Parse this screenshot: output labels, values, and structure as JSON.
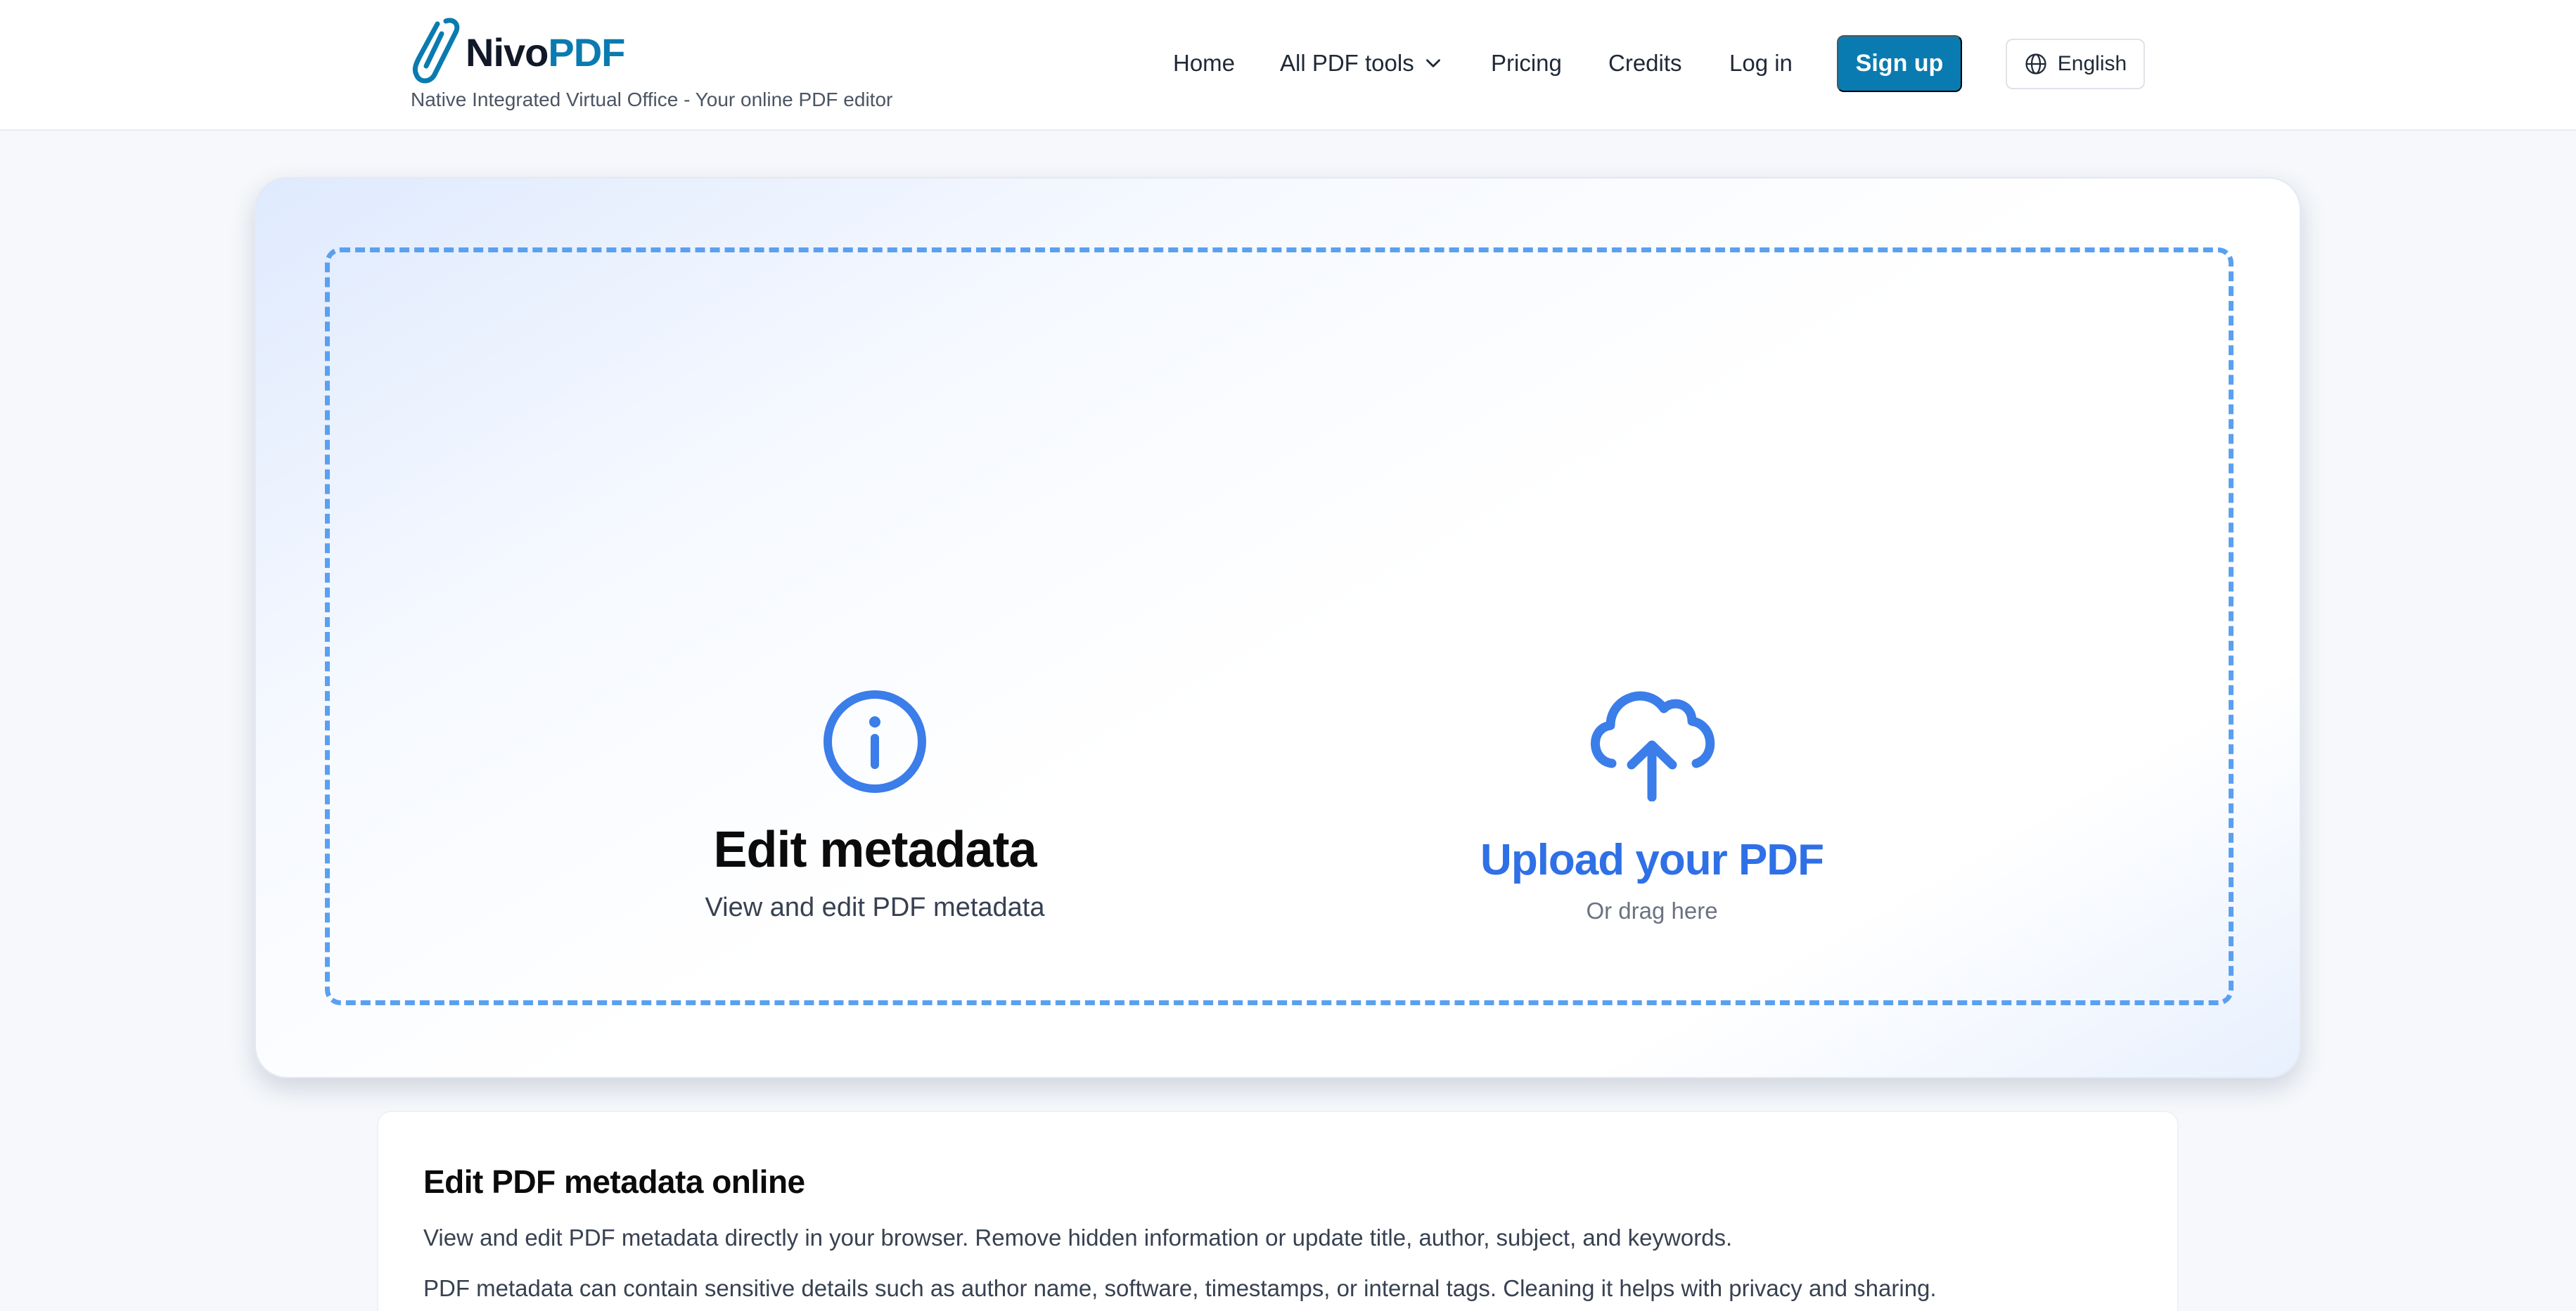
{
  "header": {
    "logo": {
      "name_part1": "Nivo",
      "name_part2": "PDF",
      "icon": "paperclip-icon"
    },
    "tagline": "Native Integrated Virtual Office - Your online PDF editor",
    "nav": {
      "home": "Home",
      "all_tools": "All PDF tools",
      "pricing": "Pricing",
      "credits": "Credits",
      "login": "Log in"
    },
    "signup": "Sign up",
    "language": "English"
  },
  "tool": {
    "icon": "info-icon",
    "title": "Edit metadata",
    "description": "View and edit PDF metadata"
  },
  "upload": {
    "icon": "cloud-upload-icon",
    "title": "Upload your PDF",
    "subtitle": "Or drag here"
  },
  "content": {
    "title": "Edit PDF metadata online",
    "paragraph1": "View and edit PDF metadata directly in your browser. Remove hidden information or update title, author, subject, and keywords.",
    "paragraph2": "PDF metadata can contain sensitive details such as author name, software, timestamps, or internal tags. Cleaning it helps with privacy and sharing."
  },
  "colors": {
    "brand": "#0a7bb0",
    "accent": "#2f70e6",
    "dropzone_border": "#5aa0f0"
  }
}
